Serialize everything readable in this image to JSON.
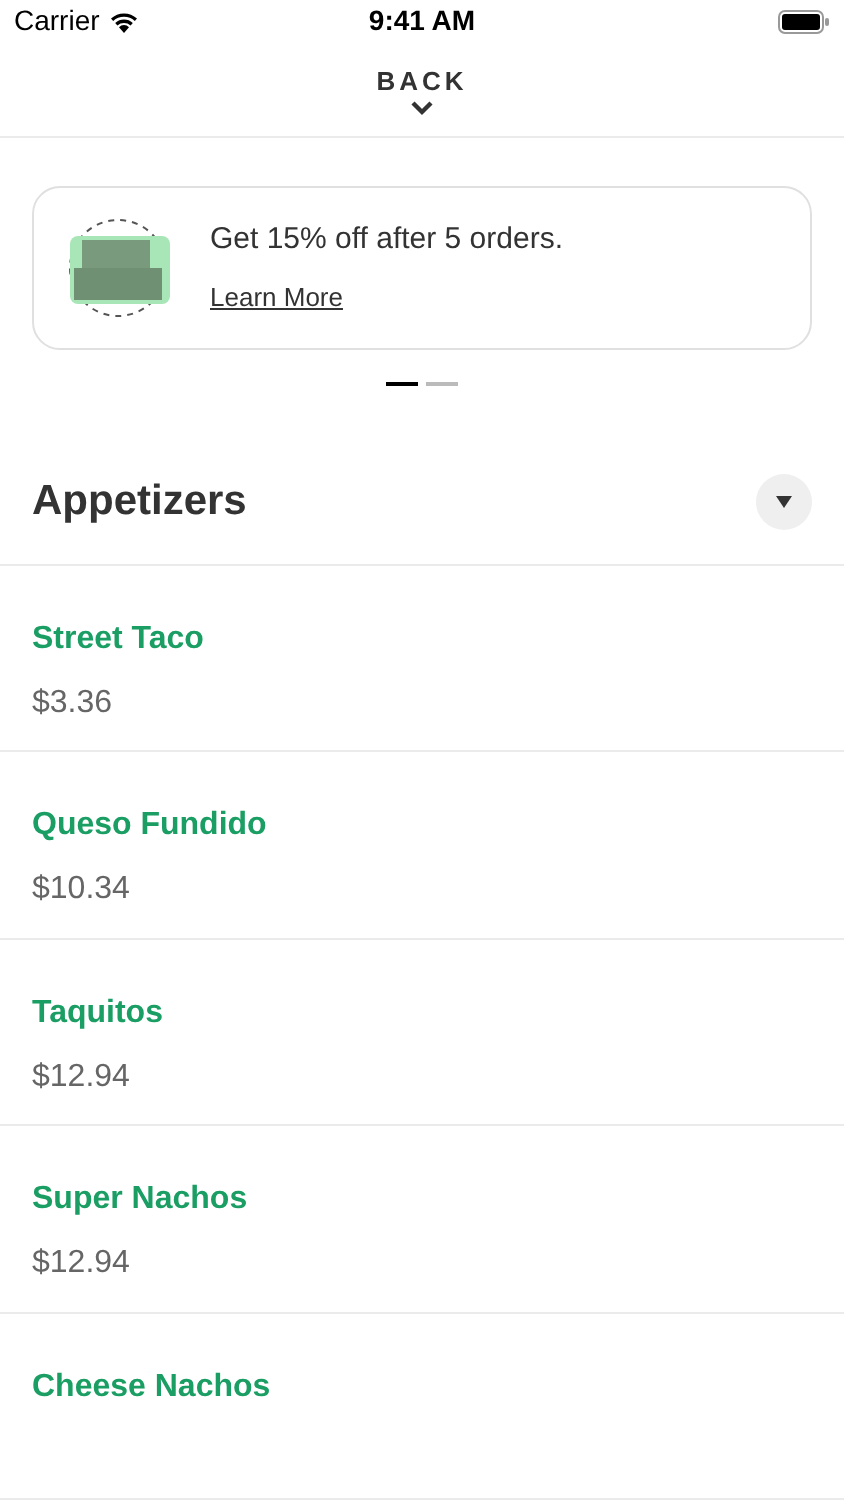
{
  "status_bar": {
    "carrier": "Carrier",
    "time": "9:41 AM"
  },
  "nav": {
    "back": "BACK"
  },
  "promo": {
    "text": "Get 15% off after 5 orders.",
    "link": "Learn More"
  },
  "carousel_dots": [
    {
      "selected": true
    },
    {
      "selected": false
    }
  ],
  "section": {
    "title": "Appetizers",
    "expanded": true
  },
  "items": [
    {
      "name": "Street Taco",
      "price": "$3.36"
    },
    {
      "name": "Queso Fundido",
      "price": "$10.34"
    },
    {
      "name": "Taquitos",
      "price": "$12.94"
    },
    {
      "name": "Super Nachos",
      "price": "$12.94"
    },
    {
      "name": "Cheese Nachos"
    }
  ]
}
